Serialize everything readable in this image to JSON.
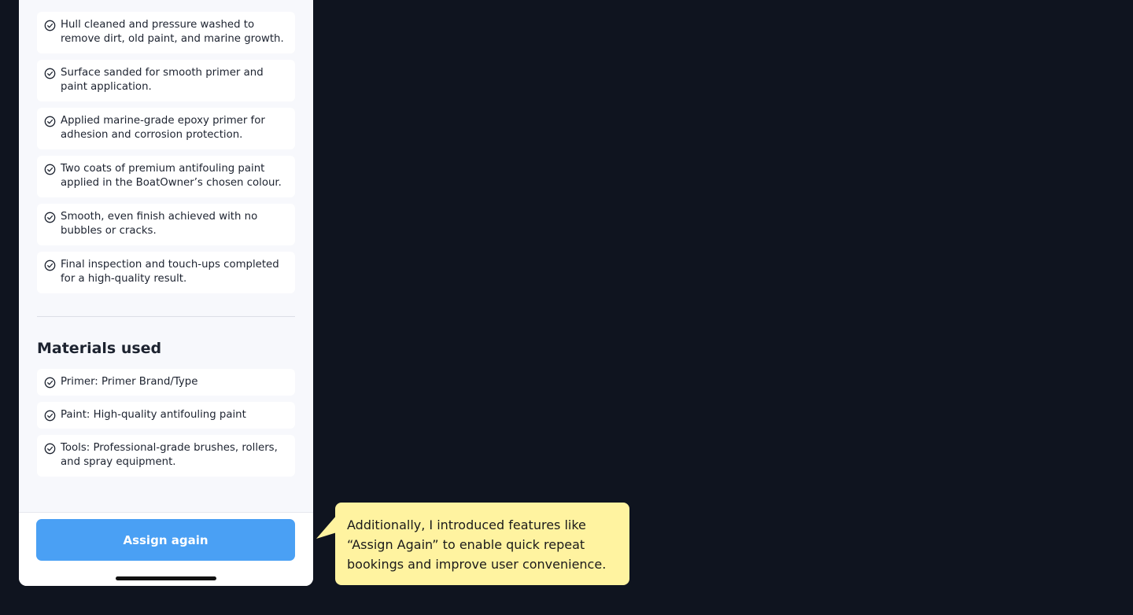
{
  "steps": [
    "Hull cleaned and pressure washed to remove dirt, old paint, and marine growth.",
    "Surface sanded for smooth primer and paint application.",
    "Applied marine-grade epoxy primer for adhesion and corrosion protection.",
    "Two coats of premium antifouling paint applied in the BoatOwner’s chosen colour.",
    "Smooth, even finish achieved with no bubbles or cracks.",
    "Final inspection and touch-ups completed for a high-quality result."
  ],
  "materials": {
    "title": "Materials used",
    "items": [
      "Primer: Primer Brand/Type",
      "Paint: High-quality antifouling paint",
      "Tools: Professional-grade brushes, rollers, and spray equipment."
    ]
  },
  "footer": {
    "assign_label": "Assign again"
  },
  "callout": {
    "text": "Additionally, I introduced features like “Assign Again” to enable quick repeat bookings and improve user convenience."
  },
  "colors": {
    "background": "#0f141f",
    "panel": "#f7f8fc",
    "card": "#ffffff",
    "accent": "#4aa0f4",
    "callout": "#fff3a0"
  },
  "icons": {
    "check": "check-circle-icon"
  }
}
